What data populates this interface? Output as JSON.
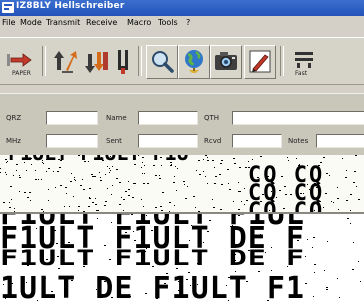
{
  "window": {
    "title": "IZ8BLY Hellschreiber"
  },
  "menu": [
    "File",
    "Mode",
    "Transmit",
    "Receive",
    "Macro",
    "Tools",
    "?"
  ],
  "toolbar": {
    "buttons": [
      {
        "name": "paper-button",
        "icon": "paper-arrow-icon",
        "label": "PAPER"
      },
      {
        "name": "transmit-button",
        "icon": "transmit-arrows-icon"
      },
      {
        "name": "receive-button",
        "icon": "receive-arrows-icon"
      },
      {
        "name": "tuning-button",
        "icon": "tuning-fork-icon"
      },
      {
        "name": "search-button",
        "icon": "magnifier-icon"
      },
      {
        "name": "globe-button",
        "icon": "globe-icon"
      },
      {
        "name": "camera-button",
        "icon": "camera-icon"
      },
      {
        "name": "edit-button",
        "icon": "pencil-icon"
      },
      {
        "name": "fast-button",
        "icon": "fast-icon",
        "label": "Fast"
      }
    ]
  },
  "fields": {
    "qrz_label": "QRZ",
    "qrz_value": "",
    "name_label": "Name",
    "name_value": "",
    "qth_label": "QTH",
    "qth_value": "",
    "mhz_label": "MHz",
    "mhz_value": "",
    "sent_label": "Sent",
    "sent_value": "",
    "rcvd_label": "Rcvd",
    "rcvd_value": "",
    "notes_label": "Notes",
    "notes_value": ""
  },
  "display": {
    "panel1_lines": [
      "CQ CQ",
      "CQ CQ",
      "CQ CQ"
    ],
    "panel1_top_fragment": "F1ULT  F1ULT  F1U",
    "panel2_lines": [
      "F1ULT F1ULT F1UL",
      "F1ULT F1ULT DE F",
      "F1ULT F1ULT DE F",
      "1ULT DE F1ULT F1"
    ]
  }
}
